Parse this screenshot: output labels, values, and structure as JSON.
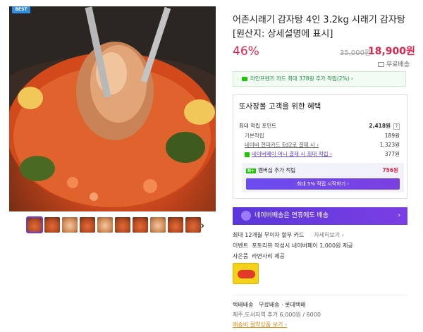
{
  "gallery": {
    "badge": "BEST",
    "thumb_count": 10,
    "next_glyph": "›"
  },
  "product": {
    "title": "어존시래기 감자탕 4인 3.2kg 시래기 감자탕 [원산지: 상세설명에 표시]",
    "discount": "46%",
    "original_price": "35,000원",
    "sale_price": "18,900원",
    "shipping_badge": "무료배송"
  },
  "card_banner": "라인프렌즈 카드 최대 378원 추가 적립(2%) ›",
  "benefits": {
    "title": "또사장몰 고객을 위한 혜택",
    "max_points_label": "최대 적립 포인트",
    "max_points_value": "2,418원",
    "rows": [
      {
        "label": "기본적립",
        "value": "189원"
      },
      {
        "label": "네이버 현대카드 Ed2로 결제 시 ›",
        "value": "1,323원"
      },
      {
        "label": "네이버페이 머니 결제 시 최대 적립 ›",
        "value": "377원"
      }
    ],
    "membership_label": "멤버십 추가 적립",
    "membership_value": "756원",
    "membership_button": "최대 5% 적립 시작하기 ›"
  },
  "nfast_banner": "네이버배송은 연휴에도 배송",
  "info": {
    "installment_label": "최대 12개월 무이자 할부 카드",
    "installment_link": "자세히보기 ›",
    "event_label": "이벤트",
    "event_text": "포토리뷰 작성시 네이버페이 1,000원 제공",
    "gift_label": "사은품",
    "gift_text": "라면사리 제공"
  },
  "delivery": {
    "label": "택배배송",
    "values": "무료배송 · 롯데택배",
    "extra": "제주,도서지역 추가 6,000원 / 6000",
    "link": "배송비 절약상품 보기 ›"
  },
  "colors": {
    "accent_red": "#e0244c",
    "accent_purple": "#6b4cf0",
    "naver_green": "#1ec800"
  }
}
